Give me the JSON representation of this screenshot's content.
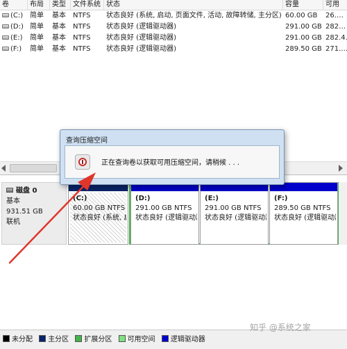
{
  "table": {
    "headers": [
      "卷",
      "布局",
      "类型",
      "文件系统",
      "状态",
      "容量",
      "可用"
    ],
    "rows": [
      [
        "(C:)",
        "简单",
        "基本",
        "NTFS",
        "状态良好 (系统, 启动, 页面文件, 活动, 故障转储, 主分区)",
        "60.00 GB",
        "26.…"
      ],
      [
        "(D:)",
        "简单",
        "基本",
        "NTFS",
        "状态良好 (逻辑驱动器)",
        "291.00 GB",
        "282…"
      ],
      [
        "(E:)",
        "简单",
        "基本",
        "NTFS",
        "状态良好 (逻辑驱动器)",
        "291.00 GB",
        "282.4…"
      ],
      [
        "(F:)",
        "简单",
        "基本",
        "NTFS",
        "状态良好 (逻辑驱动器)",
        "289.50 GB",
        "271.…"
      ]
    ]
  },
  "disk": {
    "title": "磁盘 0",
    "type": "基本",
    "size": "931.51 GB",
    "status": "联机",
    "partitions": [
      {
        "name": "(C:)",
        "size": "60.00 GB NTFS",
        "status": "状态良好 (系统, 启"
      },
      {
        "name": "(D:)",
        "size": "291.00 GB NTFS",
        "status": "状态良好 (逻辑驱动器)"
      },
      {
        "name": "(E:)",
        "size": "291.00 GB NTFS",
        "status": "状态良好 (逻辑驱动器)"
      },
      {
        "name": "(F:)",
        "size": "289.50 GB NTFS",
        "status": "状态良好 (逻辑驱动器)"
      }
    ]
  },
  "legend": [
    {
      "label": "未分配",
      "color": "#000000"
    },
    {
      "label": "主分区",
      "color": "#0a246a"
    },
    {
      "label": "扩展分区",
      "color": "#44b449"
    },
    {
      "label": "可用空间",
      "color": "#7fe07f"
    },
    {
      "label": "逻辑驱动器",
      "color": "#0000cc"
    }
  ],
  "dialog": {
    "title": "查询压缩空间",
    "message": "正在查询卷以获取可用压缩空间，请稍候 . . ."
  },
  "watermark": "知乎 @系统之家",
  "colors": {
    "primary_bar": "#0a246a",
    "logical_bar": "#0000cc",
    "extended_frame": "#44b449",
    "arrow": "#e0352b"
  }
}
